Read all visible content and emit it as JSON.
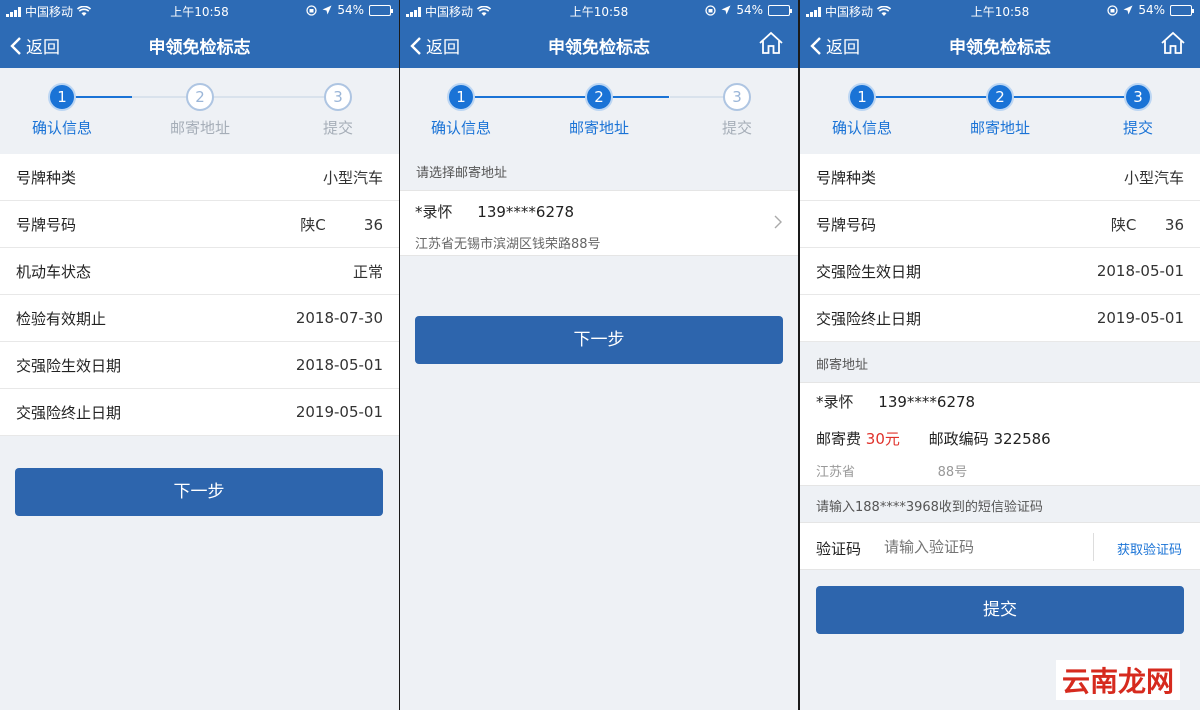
{
  "status_bar": {
    "carrier": "中国移动",
    "time": "上午10:58",
    "battery": "54%",
    "battery_level": 0.54
  },
  "nav": {
    "back_label": "返回",
    "title": "申领免检标志"
  },
  "steps": [
    {
      "num": "1",
      "label": "确认信息"
    },
    {
      "num": "2",
      "label": "邮寄地址"
    },
    {
      "num": "3",
      "label": "提交"
    }
  ],
  "screen1": {
    "rows": [
      {
        "label": "号牌种类",
        "value": "小型汽车"
      },
      {
        "label": "号牌号码",
        "value": "陕C        36"
      },
      {
        "label": "机动车状态",
        "value": "正常"
      },
      {
        "label": "检验有效期止",
        "value": "2018-07-30"
      },
      {
        "label": "交强险生效日期",
        "value": "2018-05-01"
      },
      {
        "label": "交强险终止日期",
        "value": "2019-05-01"
      }
    ],
    "next_button": "下一步"
  },
  "screen2": {
    "section_label": "请选择邮寄地址",
    "recipient_name": "*录怀",
    "recipient_phone": "139****6278",
    "address": "江苏省无锡市滨湖区钱荣路88号",
    "next_button": "下一步"
  },
  "screen3": {
    "rows": [
      {
        "label": "号牌种类",
        "value": "小型汽车"
      },
      {
        "label": "号牌号码",
        "value": "陕C      36"
      },
      {
        "label": "交强险生效日期",
        "value": "2018-05-01"
      },
      {
        "label": "交强险终止日期",
        "value": "2019-05-01"
      }
    ],
    "address_section_label": "邮寄地址",
    "recipient_name": "*录怀",
    "recipient_phone": "139****6278",
    "postage_label": "邮寄费",
    "postage_value": "30元",
    "postcode_label": "邮政编码",
    "postcode_value": "322586",
    "address_blurred": "江苏省                    88号",
    "sms_hint": "请输入188****3968收到的短信验证码",
    "code_label": "验证码",
    "code_placeholder": "请输入验证码",
    "get_code_button": "获取验证码",
    "submit_button": "提交"
  },
  "watermark": "云南龙网",
  "colors": {
    "header_bg": "#2d6bb5",
    "active_step": "#1a73d6",
    "button_bg": "#2d65ad",
    "postage_red": "#e0322b",
    "link_blue": "#1a73d6"
  }
}
